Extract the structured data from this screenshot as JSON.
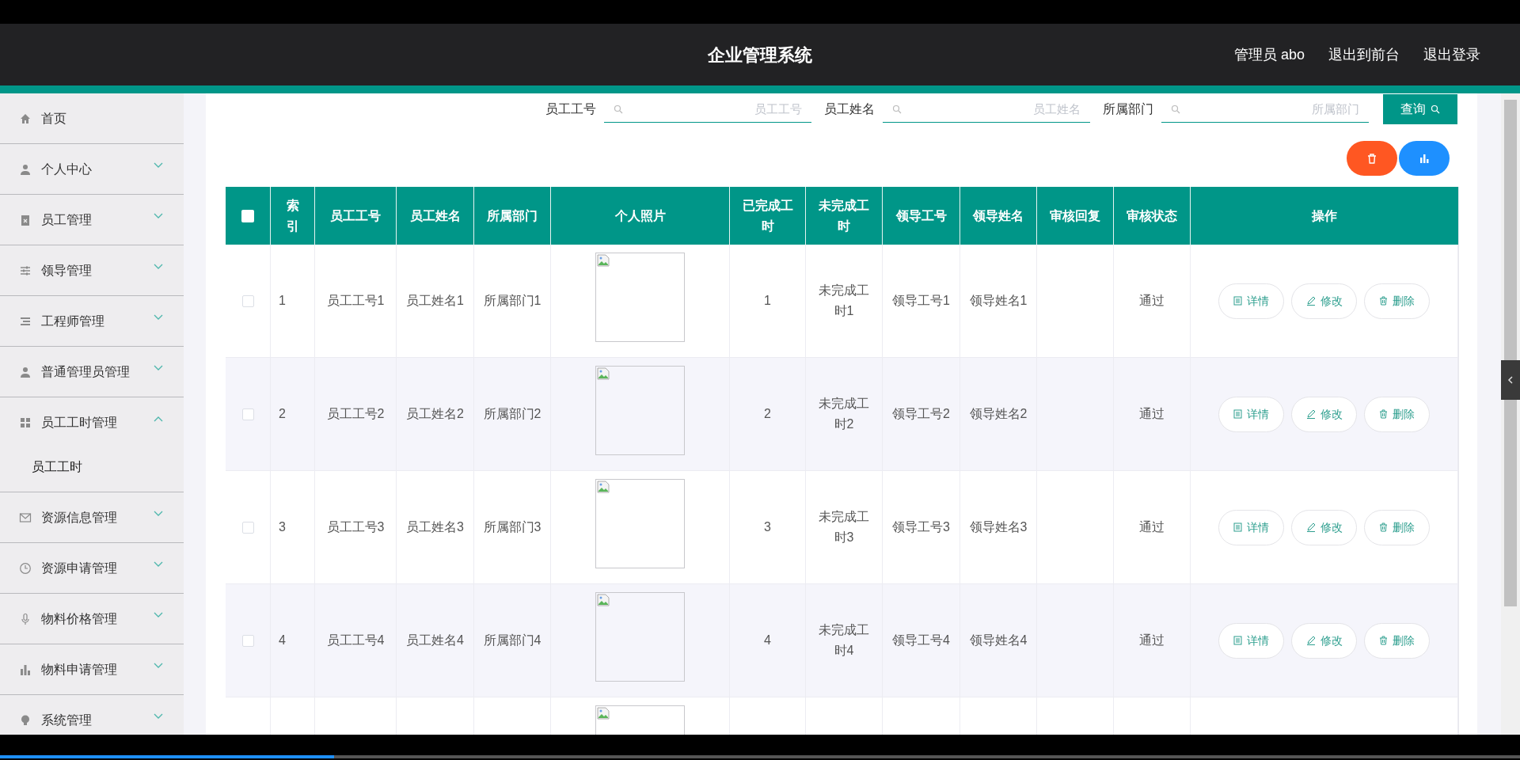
{
  "header": {
    "title": "企业管理系统",
    "links": [
      "管理员 abo",
      "退出到前台",
      "退出登录"
    ]
  },
  "sidebar": {
    "items": [
      {
        "label": "首页",
        "kind": "link"
      },
      {
        "label": "个人中心",
        "kind": "group",
        "expanded": false
      },
      {
        "label": "员工管理",
        "kind": "group",
        "expanded": false
      },
      {
        "label": "领导管理",
        "kind": "group",
        "expanded": false
      },
      {
        "label": "工程师管理",
        "kind": "group",
        "expanded": false
      },
      {
        "label": "普通管理员管理",
        "kind": "group",
        "expanded": false
      },
      {
        "label": "员工工时管理",
        "kind": "group",
        "expanded": true,
        "children": [
          {
            "label": "员工工时"
          }
        ]
      },
      {
        "label": "资源信息管理",
        "kind": "group",
        "expanded": false
      },
      {
        "label": "资源申请管理",
        "kind": "group",
        "expanded": false
      },
      {
        "label": "物料价格管理",
        "kind": "group",
        "expanded": false
      },
      {
        "label": "物料申请管理",
        "kind": "group",
        "expanded": false
      },
      {
        "label": "系统管理",
        "kind": "group",
        "expanded": false
      }
    ]
  },
  "search": {
    "fields": [
      {
        "label": "员工工号",
        "placeholder": "员工工号"
      },
      {
        "label": "员工姓名",
        "placeholder": "员工姓名"
      },
      {
        "label": "所属部门",
        "placeholder": "所属部门"
      }
    ],
    "button": "查询"
  },
  "table": {
    "all_checked": false,
    "columns": [
      "索引",
      "员工工号",
      "员工姓名",
      "所属部门",
      "个人照片",
      "已完成工时",
      "未完成工时",
      "领导工号",
      "领导姓名",
      "审核回复",
      "审核状态",
      "操作"
    ],
    "rows": [
      {
        "kind": "full",
        "checked": false,
        "cells": [
          "1",
          "员工工号1",
          "员工姓名1",
          "所属部门1",
          "1",
          "未完成工时1",
          "领导工号1",
          "领导姓名1",
          "",
          "通过"
        ],
        "actions": [
          "详情",
          "修改",
          "删除"
        ]
      },
      {
        "kind": "full",
        "checked": false,
        "cells": [
          "2",
          "员工工号2",
          "员工姓名2",
          "所属部门2",
          "2",
          "未完成工时2",
          "领导工号2",
          "领导姓名2",
          "",
          "通过"
        ],
        "actions": [
          "详情",
          "修改",
          "删除"
        ]
      },
      {
        "kind": "full",
        "checked": false,
        "cells": [
          "3",
          "员工工号3",
          "员工姓名3",
          "所属部门3",
          "3",
          "未完成工时3",
          "领导工号3",
          "领导姓名3",
          "",
          "通过"
        ],
        "actions": [
          "详情",
          "修改",
          "删除"
        ]
      },
      {
        "kind": "full",
        "checked": false,
        "cells": [
          "4",
          "员工工号4",
          "员工姓名4",
          "所属部门4",
          "4",
          "未完成工时4",
          "领导工号4",
          "领导姓名4",
          "",
          "通过"
        ],
        "actions": [
          "详情",
          "修改",
          "删除"
        ]
      },
      {
        "kind": "cut"
      }
    ]
  },
  "video_player": {
    "level": 0.22
  }
}
